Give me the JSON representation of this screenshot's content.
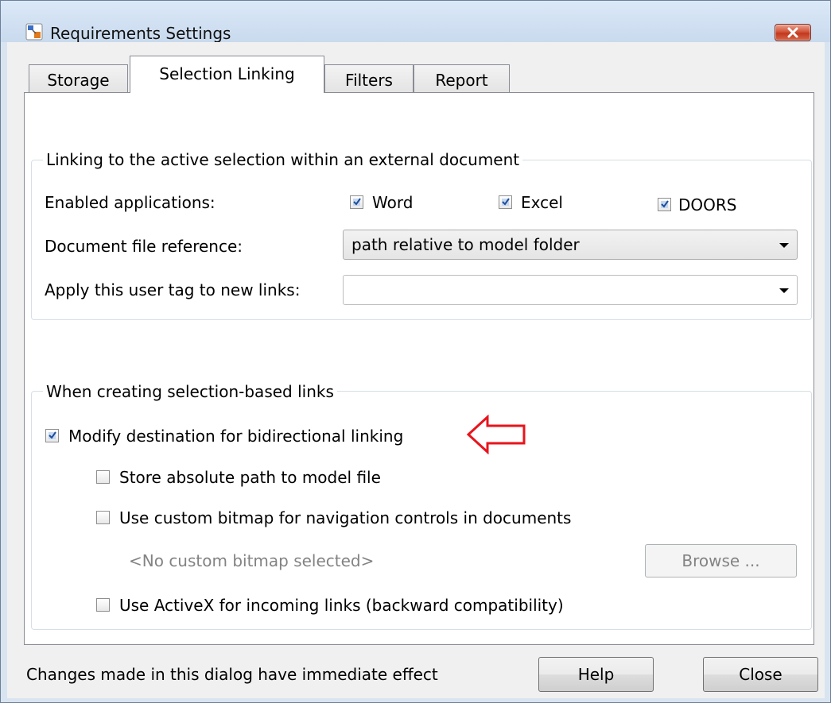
{
  "window": {
    "title": "Requirements Settings",
    "icon": "app-icon",
    "close_icon": "close-icon"
  },
  "tabs": [
    {
      "label": "Storage",
      "active": false
    },
    {
      "label": "Selection Linking",
      "active": true
    },
    {
      "label": "Filters",
      "active": false
    },
    {
      "label": "Report",
      "active": false
    }
  ],
  "external_group": {
    "legend": "Linking to the active selection within an external document",
    "enabled_apps_label": "Enabled applications:",
    "apps": [
      {
        "label": "Word",
        "checked": true
      },
      {
        "label": "Excel",
        "checked": true
      },
      {
        "label": "DOORS",
        "checked": true
      }
    ],
    "file_ref_label": "Document file reference:",
    "file_ref_value": "path relative to model folder",
    "user_tag_label": "Apply this user tag to new links:",
    "user_tag_value": ""
  },
  "selection_group": {
    "legend": "When creating selection-based links",
    "modify_dest": {
      "label": "Modify destination for bidirectional linking",
      "checked": true
    },
    "store_abs": {
      "label": "Store absolute path to model file",
      "checked": false
    },
    "custom_bitmap": {
      "label": "Use custom bitmap for navigation controls in documents",
      "checked": false
    },
    "no_bitmap_text": "<No custom bitmap selected>",
    "browse_label": "Browse ...",
    "activex": {
      "label": "Use ActiveX for incoming links (backward compatibility)",
      "checked": false
    }
  },
  "annotation": {
    "icon": "red-arrow-icon",
    "color": "#e8141c"
  },
  "footer": {
    "status": "Changes made in this dialog have immediate effect",
    "help_label": "Help",
    "close_label": "Close"
  }
}
